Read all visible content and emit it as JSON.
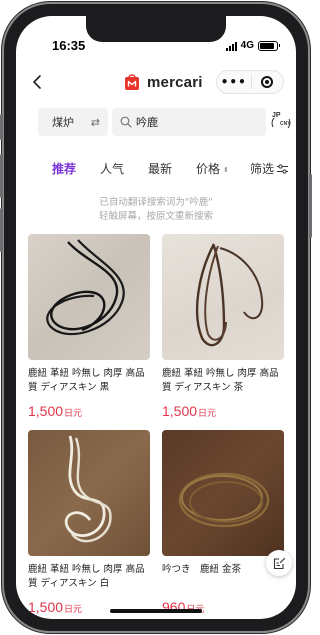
{
  "status_bar": {
    "time": "16:35",
    "network": "4G",
    "battery_level": 0.85
  },
  "header": {
    "brand": "mercari",
    "more_label": "•••"
  },
  "search": {
    "category": "煤炉",
    "swap_symbol": "⇄",
    "query": "吟鹿",
    "translate_jp": "JP",
    "translate_cn": "CNY"
  },
  "sort_tabs": [
    {
      "label": "推荐",
      "active": true
    },
    {
      "label": "人气"
    },
    {
      "label": "最新"
    },
    {
      "label": "价格"
    },
    {
      "label": "筛选"
    }
  ],
  "notice": {
    "line1": "已自动翻译搜索词为\"吟鹿\"",
    "line2": "轻触屏幕，按原文重新搜索"
  },
  "products": [
    {
      "title": "鹿紐 革紐 吟無し 肉厚 高品質 ディアスキン 黒",
      "price": "1,500",
      "currency": "日元"
    },
    {
      "title": "鹿紐 革紐 吟無し 肉厚 高品質 ディアスキン 茶",
      "price": "1,500",
      "currency": "日元"
    },
    {
      "title": "鹿紐 革紐 吟無し 肉厚 高品質 ディアスキン 白",
      "price": "1,500",
      "currency": "日元"
    },
    {
      "title": "吟つき　鹿紐 金茶",
      "price": "960",
      "currency": "日元"
    }
  ],
  "colors": {
    "accent": "#7b35d6",
    "price": "#e0354a",
    "brand_red": "#e8332a"
  }
}
